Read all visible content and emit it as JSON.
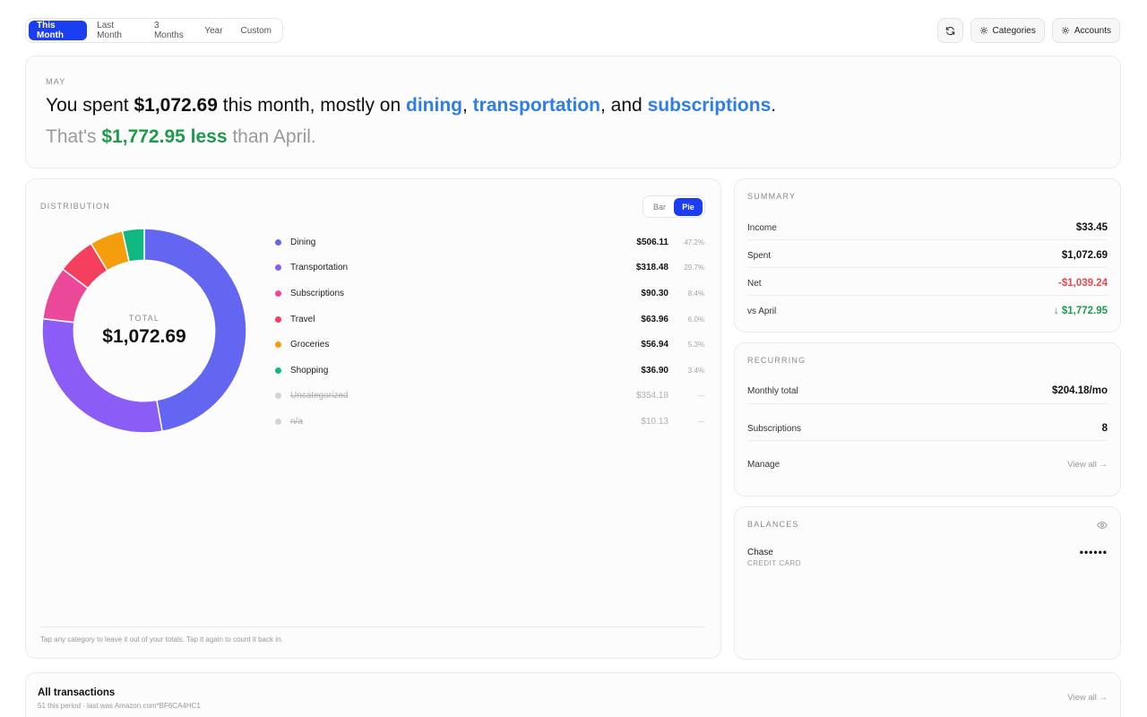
{
  "range_tabs": [
    "This Month",
    "Last Month",
    "3 Months",
    "Year",
    "Custom"
  ],
  "actions": {
    "refresh_icon": "refresh-icon",
    "categories_label": "Categories",
    "accounts_label": "Accounts"
  },
  "hero": {
    "month": "MAY",
    "prefix": "You spent ",
    "amount": "$1,072.69",
    "middle": " this month, mostly on ",
    "cat1": "dining",
    "sep1": ", ",
    "cat2": "transportation",
    "sep2": ", and ",
    "cat3": "subscriptions",
    "end": ".",
    "compare_prefix": "That's ",
    "compare_amount": "$1,772.95 less",
    "compare_suffix": " than April."
  },
  "distribution": {
    "title": "DISTRIBUTION",
    "toggle": [
      "Bar",
      "Pie"
    ],
    "total_label": "TOTAL",
    "total_value": "$1,072.69",
    "hint": "Tap any category to leave it out of your totals. Tap it again to count it back in."
  },
  "chart_data": {
    "type": "pie",
    "categories": [
      "Dining",
      "Transportation",
      "Subscriptions",
      "Travel",
      "Groceries",
      "Shopping",
      "Uncategorized",
      "n/a"
    ],
    "values": [
      506.11,
      318.48,
      90.3,
      63.96,
      56.94,
      36.9,
      354.18,
      10.13
    ],
    "amount_labels": [
      "$506.11",
      "$318.48",
      "$90.30",
      "$63.96",
      "$56.94",
      "$36.90",
      "$354.18",
      "$10.13"
    ],
    "percent_labels": [
      "47.2%",
      "29.7%",
      "8.4%",
      "6.0%",
      "5.3%",
      "3.4%",
      "—",
      "—"
    ],
    "excluded": [
      false,
      false,
      false,
      false,
      false,
      false,
      true,
      true
    ],
    "colors": [
      "#6366f1",
      "#8b5cf6",
      "#ec4899",
      "#f43f5e",
      "#f59e0b",
      "#10b981",
      "#d4d4d4",
      "#d4d4d4"
    ],
    "hole_ratio": 0.69
  },
  "summary": {
    "title": "SUMMARY",
    "rows": [
      {
        "label": "Income",
        "value": "$33.45",
        "color": "#111111"
      },
      {
        "label": "Spent",
        "value": "$1,072.69",
        "color": "#111111"
      },
      {
        "label": "Net",
        "value": "-$1,039.24",
        "color": "#e5484d"
      },
      {
        "label": "vs April",
        "value": "↓ $1,772.95",
        "color": "#1d9a4b"
      }
    ]
  },
  "recurring": {
    "title": "RECURRING",
    "monthly_label": "Monthly total",
    "monthly_value": "$204.18/mo",
    "subs_label": "Subscriptions",
    "subs_value": "8",
    "manage_label": "Manage",
    "view_all": "View all →"
  },
  "balances": {
    "title": "BALANCES",
    "eye_icon": "eye-icon",
    "account_name": "Chase",
    "account_type": "CREDIT CARD",
    "masked_value": "••••••"
  },
  "transactions": {
    "title": "All transactions",
    "subtitle": "51 this period · last was Amazon.com*BF6CA4HC1",
    "view_all": "View all →"
  }
}
